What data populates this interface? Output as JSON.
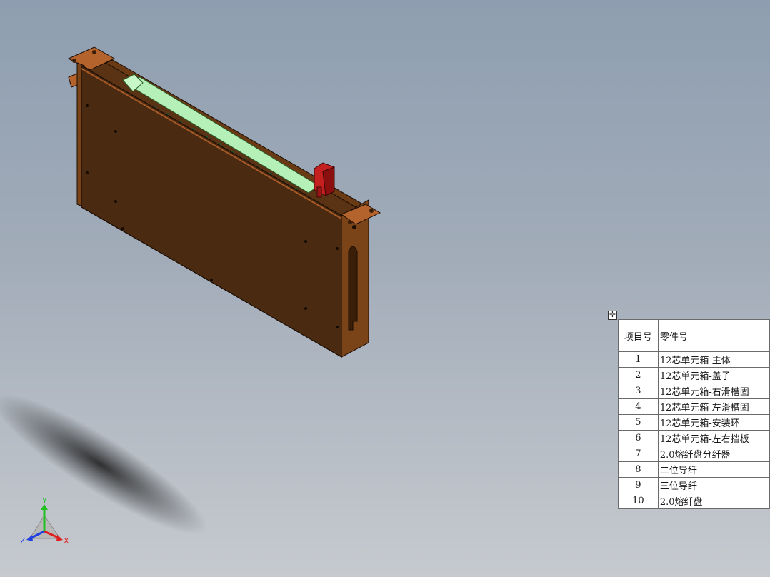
{
  "bom": {
    "headers": {
      "item_no": "项目号",
      "part_no": "零件号"
    },
    "rows": [
      {
        "item": "1",
        "part": "12芯单元箱-主体"
      },
      {
        "item": "2",
        "part": "12芯单元箱-盖子"
      },
      {
        "item": "3",
        "part": "12芯单元箱-右滑槽固"
      },
      {
        "item": "4",
        "part": "12芯单元箱-左滑槽固"
      },
      {
        "item": "5",
        "part": "12芯单元箱-安装环"
      },
      {
        "item": "6",
        "part": "12芯单元箱-左右挡板"
      },
      {
        "item": "7",
        "part": "2.0熔纤盘分纤器"
      },
      {
        "item": "8",
        "part": "二位导纤"
      },
      {
        "item": "9",
        "part": "三位导纤"
      },
      {
        "item": "10",
        "part": "2.0熔纤盘"
      }
    ]
  },
  "triad": {
    "x_label": "X",
    "y_label": "Y",
    "z_label": "Z"
  },
  "icons": {
    "table_anchor": "move-cross-icon"
  },
  "colors": {
    "background_top": "#8e9eb0",
    "background_bottom": "#c6cacf",
    "box_body": "#4a2a10",
    "box_flange": "#b5632c",
    "rail": "#b4f0b8",
    "bracket": "#c42020",
    "axis_x": "#e02020",
    "axis_y": "#20c020",
    "axis_z": "#2040e0"
  }
}
